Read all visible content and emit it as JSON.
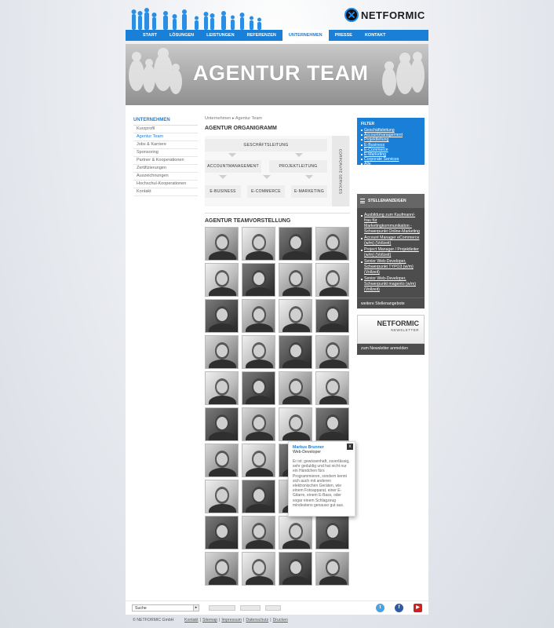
{
  "brand": {
    "name": "NETFORMIC"
  },
  "nav": [
    {
      "label": "Start"
    },
    {
      "label": "Lösungen"
    },
    {
      "label": "Leistungen"
    },
    {
      "label": "Referenzen"
    },
    {
      "label": "Unternehmen"
    },
    {
      "label": "Presse"
    },
    {
      "label": "Kontakt"
    }
  ],
  "nav_active_index": 4,
  "banner": {
    "title": "AGENTUR TEAM"
  },
  "sidebar": {
    "title": "UNTERNEHMEN",
    "items": [
      {
        "label": "Kurzprofil"
      },
      {
        "label": "Agentur Team"
      },
      {
        "label": "Jobs & Karriere"
      },
      {
        "label": "Sponsoring"
      },
      {
        "label": "Partner & Kooperationen"
      },
      {
        "label": "Zertifizierungen"
      },
      {
        "label": "Auszeichnungen"
      },
      {
        "label": "Hochschul-Kooperationen"
      },
      {
        "label": "Kontakt"
      }
    ],
    "active_index": 1
  },
  "main": {
    "breadcrumb": "Unternehmen ▸ Agentur Team",
    "org_heading": "AGENTUR ORGANIGRAMM",
    "org": {
      "geschaeftsleitung": "Geschäftsleitung",
      "accountmanagement": "Accountmanagement",
      "projektleitung": "Projektleitung",
      "ebusiness": "E-Business",
      "ecommerce": "E-Commerce",
      "emarketing": "E-Marketing",
      "corporate_services": "Corporate Services"
    },
    "team_heading": "AGENTUR TEAMVORSTELLUNG",
    "team_rows": 10,
    "team_cols": 4
  },
  "filter": {
    "title": "FILTER",
    "items": [
      {
        "label": "Geschäftsleitung"
      },
      {
        "label": "Accountmanagement"
      },
      {
        "label": "Projektleitung"
      },
      {
        "label": "E-Business"
      },
      {
        "label": "E-Commerce"
      },
      {
        "label": "E-Marketing"
      },
      {
        "label": "Corporate Services"
      },
      {
        "label": "Alle"
      }
    ]
  },
  "jobs": {
    "title": "STELLENANZEIGEN",
    "items": [
      {
        "label": "Ausbildung zum Kaufmann/-frau für Marketingkommunikation - Schwerpunkt Online-Marketing"
      },
      {
        "label": "Account Manager eCommerce (w/m) (Vollzeit)"
      },
      {
        "label": "Project Manager / Projektleiter (w/m) (Vollzeit)"
      },
      {
        "label": "Senior Web-Developer, Schwerpunkt TYPO3 (w/m) (Vollzeit)"
      },
      {
        "label": "Senior Web-Developer, Schwerpunkt magento (w/m) (Vollzeit)"
      }
    ],
    "more": "weitere Stellenangebote"
  },
  "newsletter": {
    "brand": "NETFORMIC",
    "sub": "NEWSLETTER",
    "link": "zum Newsletter anmelden"
  },
  "popup": {
    "close": "x",
    "name": "Markus Brunner",
    "role": "Web-Developer",
    "text": "Er ist: gewissenhaft, zuverlässig, sehr geduldig und hat nicht nur ein Händchen fürs Programmieren, sondern kennt sich auch mit anderen elektronischen Geräten, wie einem Fotoapparat, einer E-Gitarre, einem E-Bass, oder sogar einem Schlagzeug mindestens genauso gut aus."
  },
  "footer": {
    "search_value": "Suche",
    "copyright": "© NETFORMIC GmbH",
    "links": [
      {
        "label": "Kontakt"
      },
      {
        "label": "Sitemap"
      },
      {
        "label": "Impressum"
      },
      {
        "label": "Datenschutz"
      },
      {
        "label": "Drucken"
      }
    ],
    "socials": [
      {
        "icon": "twitter-icon",
        "glyph": "t"
      },
      {
        "icon": "facebook-icon",
        "glyph": "f"
      },
      {
        "icon": "youtube-icon",
        "glyph": "▶"
      }
    ]
  },
  "colors": {
    "accent": "#1a7fd6",
    "dark_panel": "#4d4d4d"
  }
}
